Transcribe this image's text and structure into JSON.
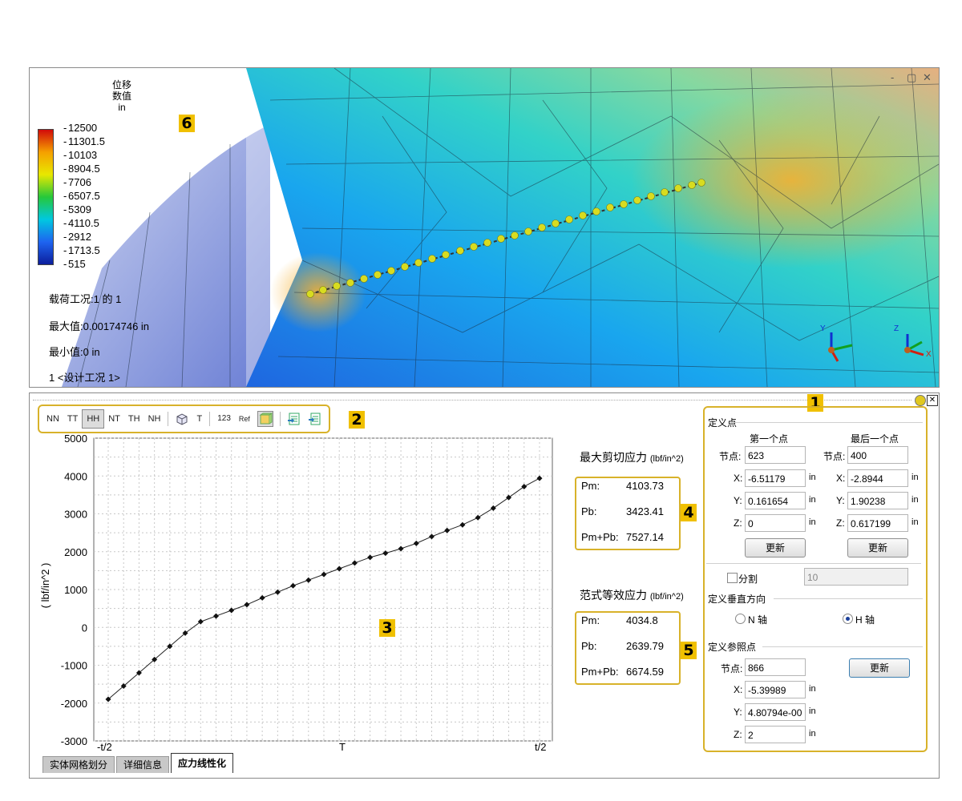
{
  "viewport": {
    "legend": {
      "title_lines": [
        "位移",
        "数值",
        "in"
      ],
      "values": [
        "12500",
        "11301.5",
        "10103",
        "8904.5",
        "7706",
        "6507.5",
        "5309",
        "4110.5",
        "2912",
        "1713.5",
        "515"
      ],
      "colors": [
        "#d10a0a",
        "#f5a000",
        "#e8e800",
        "#26c83a",
        "#00c8e0",
        "#1e64f0",
        "#0c1e9c"
      ]
    },
    "info": {
      "load_case": "载荷工况:1 的 1",
      "max": "最大值:0.00174746 in",
      "min": "最小值:0 in",
      "design_case": "1 <设计工况 1>"
    },
    "badge": "6",
    "window_controls": [
      "-",
      "▢",
      "✕"
    ],
    "triad_labels": [
      "Y",
      "Z",
      "X"
    ]
  },
  "toolbar": {
    "buttons": [
      "NN",
      "TT",
      "HH",
      "NT",
      "TH",
      "NH"
    ],
    "active": "HH",
    "extra_labels": [
      "T",
      "123",
      "Ref"
    ],
    "badge": "2"
  },
  "chart_data": {
    "type": "line",
    "ylabel": "( lbf/in^2 )",
    "xlabel": "T",
    "x_tick_labels": [
      "-t/2",
      "T",
      "t/2"
    ],
    "ylim": [
      -3000,
      5000
    ],
    "y_ticks": [
      5000,
      4000,
      3000,
      2000,
      1000,
      0,
      -1000,
      -2000,
      -3000
    ],
    "grid": true,
    "series": [
      {
        "values": [
          -1900,
          -1550,
          -1200,
          -850,
          -500,
          -150,
          150,
          300,
          450,
          600,
          780,
          930,
          1100,
          1250,
          1400,
          1550,
          1700,
          1850,
          1960,
          2080,
          2220,
          2400,
          2560,
          2710,
          2900,
          3150,
          3430,
          3720,
          3940
        ]
      }
    ],
    "badge": "3"
  },
  "results": {
    "shear": {
      "title": "最大剪切应力",
      "unit": "(lbf/in^2)",
      "pm_label": "Pm:",
      "pm": "4103.73",
      "pb_label": "Pb:",
      "pb": "3423.41",
      "pmpb_label": "Pm+Pb:",
      "pmpb": "7527.14",
      "badge": "4"
    },
    "vonmises": {
      "title": "范式等效应力",
      "unit": "(lbf/in^2)",
      "pm_label": "Pm:",
      "pm": "4034.8",
      "pb_label": "Pb:",
      "pb": "2639.79",
      "pmpb_label": "Pm+Pb:",
      "pmpb": "6674.59",
      "badge": "5"
    }
  },
  "settings": {
    "badge": "1",
    "define_points": "定义点",
    "first_point": "第一个点",
    "last_point": "最后一个点",
    "node_label": "节点:",
    "first": {
      "node": "623",
      "x": "-6.51179",
      "y": "0.161654",
      "z": "0"
    },
    "last": {
      "node": "400",
      "x": "-2.8944",
      "y": "1.90238",
      "z": "0.617199"
    },
    "x_label": "X:",
    "y_label": "Y:",
    "z_label": "Z:",
    "unit": "in",
    "update": "更新",
    "split_label": "分割",
    "split_value": "10",
    "define_normal": "定义垂直方向",
    "n_axis": "N 轴",
    "h_axis": "H 轴",
    "define_ref": "定义参照点",
    "ref": {
      "node": "866",
      "x": "-5.39989",
      "y": "4.80794e-00",
      "z": "2"
    }
  },
  "tabs": [
    "实体网格划分",
    "详细信息",
    "应力线性化"
  ],
  "active_tab": "应力线性化"
}
